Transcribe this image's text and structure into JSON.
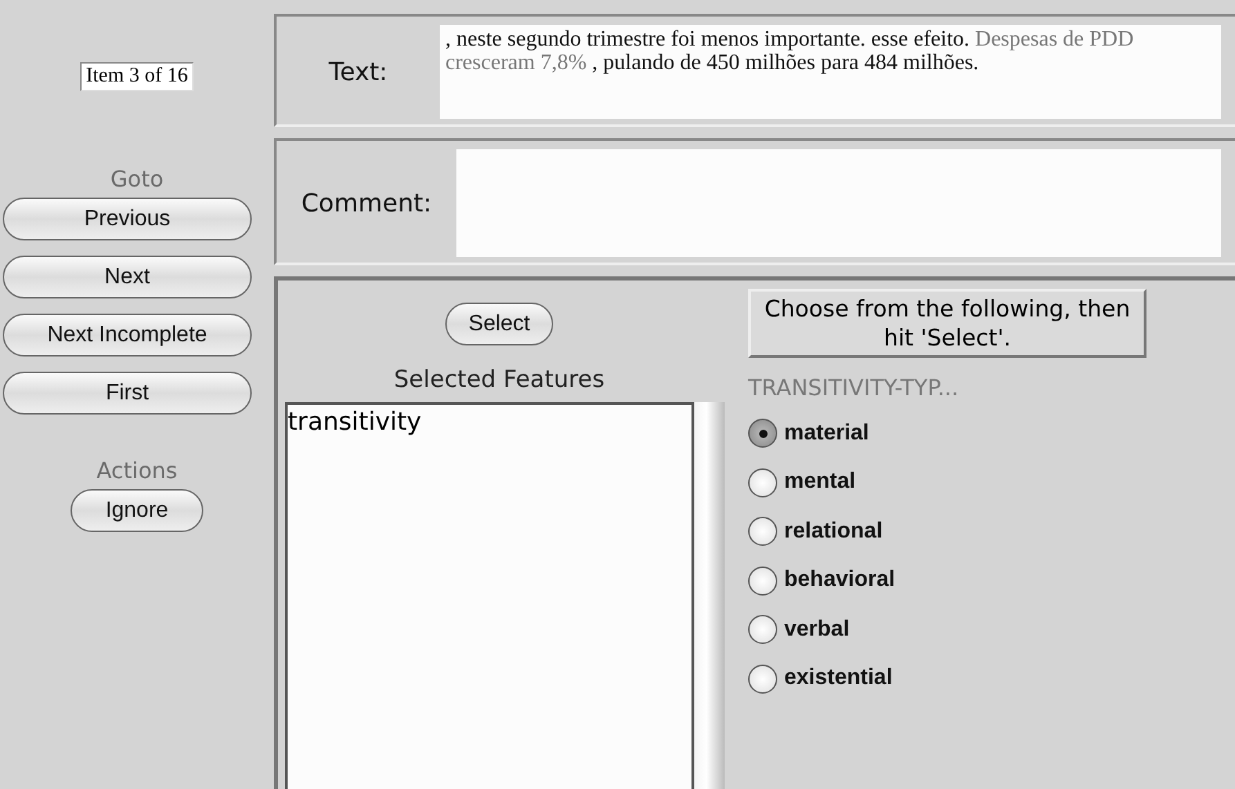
{
  "item_counter": "Item 3 of 16",
  "goto": {
    "heading": "Goto",
    "buttons": [
      "Previous",
      "Next",
      "Next Incomplete",
      "First"
    ]
  },
  "actions": {
    "heading": "Actions",
    "buttons": [
      "Ignore"
    ]
  },
  "text_panel": {
    "label": "Text:",
    "segments": [
      {
        "text": ", neste segundo trimestre foi menos importante. esse efeito. ",
        "highlighted": false
      },
      {
        "text": "Despesas de PDD cresceram 7,8%",
        "highlighted": true
      },
      {
        "text": " , pulando de 450 milhões para 484 milhões.",
        "highlighted": false
      }
    ]
  },
  "comment_panel": {
    "label": "Comment:"
  },
  "select_button": "Select",
  "selected_features": {
    "heading": "Selected Features",
    "items": [
      "transitivity"
    ]
  },
  "instructions": "Choose from the following, then hit 'Select'.",
  "options": {
    "heading": "TRANSITIVITY-TYP...",
    "items": [
      {
        "label": "material",
        "selected": true
      },
      {
        "label": "mental",
        "selected": false
      },
      {
        "label": "relational",
        "selected": false
      },
      {
        "label": "behavioral",
        "selected": false
      },
      {
        "label": "verbal",
        "selected": false
      },
      {
        "label": "existential",
        "selected": false
      }
    ]
  }
}
